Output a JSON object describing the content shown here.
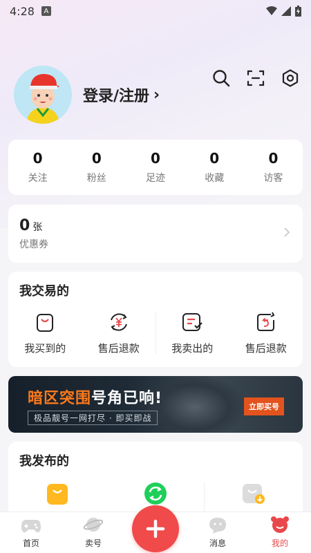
{
  "status_bar": {
    "time": "4:28",
    "badge": "A"
  },
  "profile": {
    "login_label": "登录/注册",
    "chevron": "›"
  },
  "top_icons": [
    "search-icon",
    "scan-icon",
    "settings-icon"
  ],
  "stats": [
    {
      "value": "0",
      "label": "关注"
    },
    {
      "value": "0",
      "label": "粉丝"
    },
    {
      "value": "0",
      "label": "足迹"
    },
    {
      "value": "0",
      "label": "收藏"
    },
    {
      "value": "0",
      "label": "访客"
    }
  ],
  "coupon": {
    "count": "0",
    "unit": "张",
    "label": "优惠券"
  },
  "trade": {
    "title": "我交易的",
    "items": [
      {
        "label": "我买到的",
        "icon": "bag-icon"
      },
      {
        "label": "售后退款",
        "icon": "refund-yen-icon"
      },
      {
        "label": "我卖出的",
        "icon": "sold-doc-icon"
      },
      {
        "label": "售后退款",
        "icon": "refund-return-icon"
      }
    ]
  },
  "banner": {
    "headline_orange": "暗区突围",
    "headline_white": "号角已响!",
    "subtitle": "极品靓号一网打尽 · 即买即战",
    "button": "立即买号"
  },
  "publish": {
    "title": "我发布的"
  },
  "tabbar": {
    "items": [
      {
        "label": "首页",
        "icon": "gamepad-icon"
      },
      {
        "label": "卖号",
        "icon": "planet-icon"
      },
      {
        "label": "",
        "icon": "plus-icon"
      },
      {
        "label": "消息",
        "icon": "chat-icon"
      },
      {
        "label": "我的",
        "icon": "profile-icon"
      }
    ],
    "active_color": "#e8484a"
  },
  "colors": {
    "accent": "#f04a4a",
    "orange": "#ff7a1a",
    "yellow": "#ffb81f",
    "green": "#1fcf5a"
  }
}
